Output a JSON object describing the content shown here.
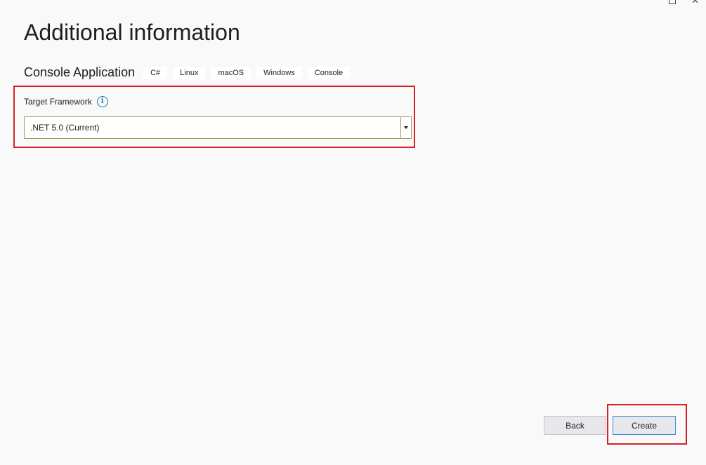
{
  "window": {
    "controls": [
      "maximize-icon",
      "close-icon"
    ],
    "close_glyph": "✕"
  },
  "page": {
    "title": "Additional information"
  },
  "template": {
    "name": "Console Application",
    "tags": [
      "C#",
      "Linux",
      "macOS",
      "Windows",
      "Console"
    ]
  },
  "framework": {
    "label": "Target Framework",
    "info_glyph": "i",
    "selected": ".NET 5.0 (Current)"
  },
  "footer": {
    "back_label": "Back",
    "create_label": "Create"
  },
  "colors": {
    "highlight": "#d1232a",
    "info": "#1f78b4",
    "focus_border": "#3b8fd6",
    "background": "#f9f9f9"
  }
}
